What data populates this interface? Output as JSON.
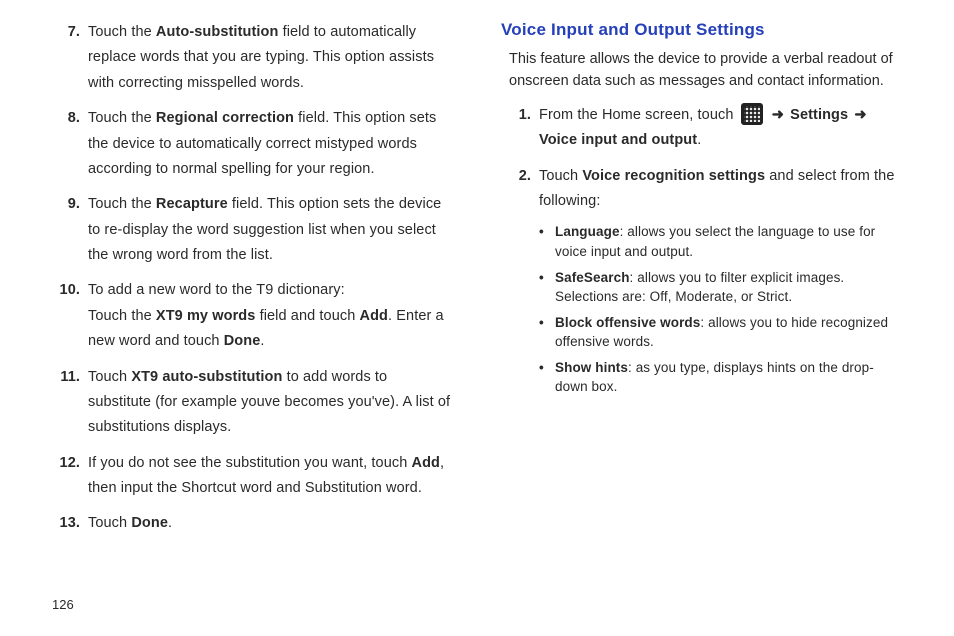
{
  "page_number": "126",
  "left_column": {
    "items": [
      {
        "num": "7.",
        "runs": [
          {
            "t": "Touch the "
          },
          {
            "t": "Auto-substitution",
            "b": true
          },
          {
            "t": " field to automatically replace words that you are typing. This option assists with correcting misspelled words."
          }
        ]
      },
      {
        "num": "8.",
        "runs": [
          {
            "t": "Touch the "
          },
          {
            "t": "Regional correction",
            "b": true
          },
          {
            "t": " field. This option sets the device to automatically correct mistyped words according to normal spelling for your region."
          }
        ]
      },
      {
        "num": "9.",
        "runs": [
          {
            "t": "Touch the "
          },
          {
            "t": "Recapture",
            "b": true
          },
          {
            "t": " field. This option sets the device to re-display the word suggestion list when you select the wrong word from the list."
          }
        ]
      },
      {
        "num": "10.",
        "runs": [
          {
            "t": "To add a new word to the T9 dictionary:"
          },
          {
            "br": true
          },
          {
            "t": "Touch the "
          },
          {
            "t": "XT9 my words",
            "b": true
          },
          {
            "t": " field and touch "
          },
          {
            "t": "Add",
            "b": true
          },
          {
            "t": ". Enter a new word and touch "
          },
          {
            "t": "Done",
            "b": true
          },
          {
            "t": "."
          }
        ]
      },
      {
        "num": "11.",
        "runs": [
          {
            "t": "Touch "
          },
          {
            "t": "XT9 auto-substitution",
            "b": true
          },
          {
            "t": " to add words to substitute (for example youve becomes you've). A list of substitutions displays."
          }
        ]
      },
      {
        "num": "12.",
        "runs": [
          {
            "t": "If you do not see the substitution you want, touch "
          },
          {
            "t": "Add",
            "b": true
          },
          {
            "t": ", then input the Shortcut word and Substitution word."
          }
        ]
      },
      {
        "num": "13.",
        "runs": [
          {
            "t": "Touch "
          },
          {
            "t": "Done",
            "b": true
          },
          {
            "t": "."
          }
        ]
      }
    ]
  },
  "right_column": {
    "heading": "Voice Input and Output Settings",
    "intro": "This feature allows the device to provide a verbal readout of onscreen data such as messages and contact information.",
    "items": [
      {
        "num": "1.",
        "runs": [
          {
            "t": "From the Home screen, touch "
          },
          {
            "icon": "apps-grid-icon"
          },
          {
            "t": " "
          },
          {
            "arrow": true
          },
          {
            "t": " "
          },
          {
            "t": "Settings",
            "b": true
          },
          {
            "t": " "
          },
          {
            "arrow": true
          },
          {
            "t": " "
          },
          {
            "t": "Voice input and output",
            "b": true
          },
          {
            "t": "."
          }
        ]
      },
      {
        "num": "2.",
        "runs": [
          {
            "t": "Touch "
          },
          {
            "t": "Voice recognition settings",
            "b": true
          },
          {
            "t": " and select from the following:"
          }
        ],
        "bullets": [
          {
            "runs": [
              {
                "t": "Language",
                "b": true
              },
              {
                "t": ": allows you select the language to use for voice input and output."
              }
            ]
          },
          {
            "runs": [
              {
                "t": "SafeSearch",
                "b": true
              },
              {
                "t": ": allows you to filter explicit images. Selections are: Off, Moderate, or Strict."
              }
            ]
          },
          {
            "runs": [
              {
                "t": "Block offensive words",
                "b": true
              },
              {
                "t": ": allows you to hide recognized offensive words."
              }
            ]
          },
          {
            "runs": [
              {
                "t": "Show hints",
                "b": true
              },
              {
                "t": ": as you type, displays hints on the drop-down box."
              }
            ]
          }
        ]
      }
    ]
  }
}
